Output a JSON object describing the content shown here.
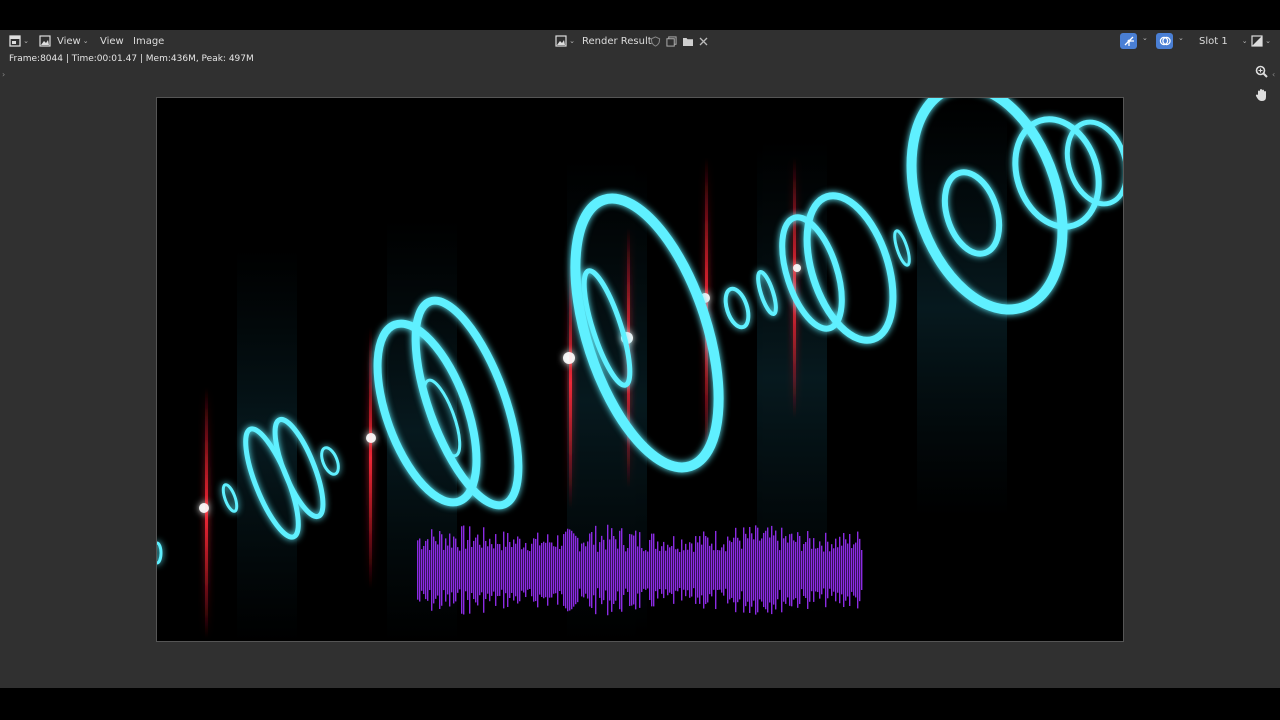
{
  "header": {
    "menu_view_dropdown": "View",
    "menu_view": "View",
    "menu_image": "Image",
    "image_name": "Render Result",
    "slot": "Slot 1"
  },
  "info": {
    "text": "Frame:8044 | Time:00:01.47 | Mem:436M, Peak: 497M"
  },
  "icons": {
    "editor_type": "image-editor-icon",
    "display_mode": "image-icon",
    "browse_image": "image-browse-icon",
    "fake_user": "shield-icon",
    "new_image": "duplicate-icon",
    "open_image": "folder-icon",
    "unlink": "close-icon",
    "gizmo": "gizmo-icon",
    "overlay": "overlay-icon",
    "channels": "channels-icon",
    "zoom": "zoom-icon",
    "pan": "hand-icon"
  },
  "colors": {
    "editor_bg": "#303030",
    "accent_blue": "#4a7fd4",
    "ring_cyan": "#5ff0ff",
    "flare_red": "#ff2a3a",
    "waveform_purple": "#8a2be2"
  }
}
